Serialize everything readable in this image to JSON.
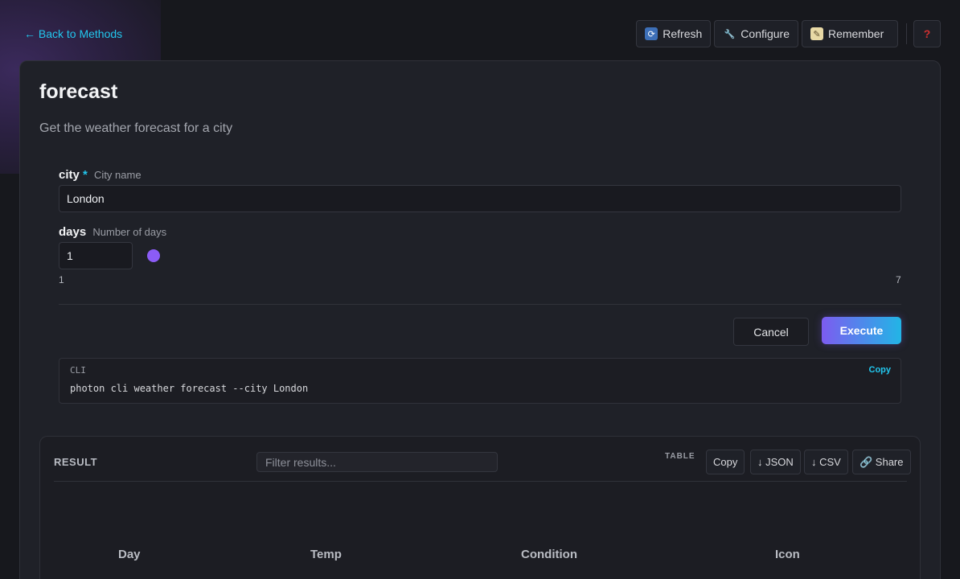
{
  "nav": {
    "back_label": "← Back to Methods"
  },
  "toolbar": {
    "refresh_label": "Refresh",
    "configure_label": "Configure",
    "remember_label": "Remember",
    "help_label": "?"
  },
  "method": {
    "title": "forecast",
    "description": "Get the weather forecast for a city"
  },
  "fields": {
    "city": {
      "name": "city",
      "required_mark": "*",
      "hint": "City name",
      "value": "London"
    },
    "days": {
      "name": "days",
      "hint": "Number of days",
      "value": "1",
      "min_label": "1",
      "max_label": "7",
      "slider_value": 1
    }
  },
  "actions": {
    "cancel_label": "Cancel",
    "execute_label": "Execute"
  },
  "cli": {
    "label": "CLI",
    "copy_label": "Copy",
    "command": "photon cli weather forecast --city London"
  },
  "result": {
    "title": "RESULT",
    "filter_placeholder": "Filter results...",
    "view_label": "TABLE",
    "copy_label": "Copy",
    "json_label": "↓ JSON",
    "csv_label": "↓ CSV",
    "share_label": "🔗 Share",
    "columns": [
      "Day",
      "Temp",
      "Condition",
      "Icon"
    ]
  },
  "colors": {
    "accent": "#22c7ee",
    "primary_start": "#7c5cf0",
    "primary_end": "#22b5e6",
    "slider": "#8b5cf6"
  }
}
